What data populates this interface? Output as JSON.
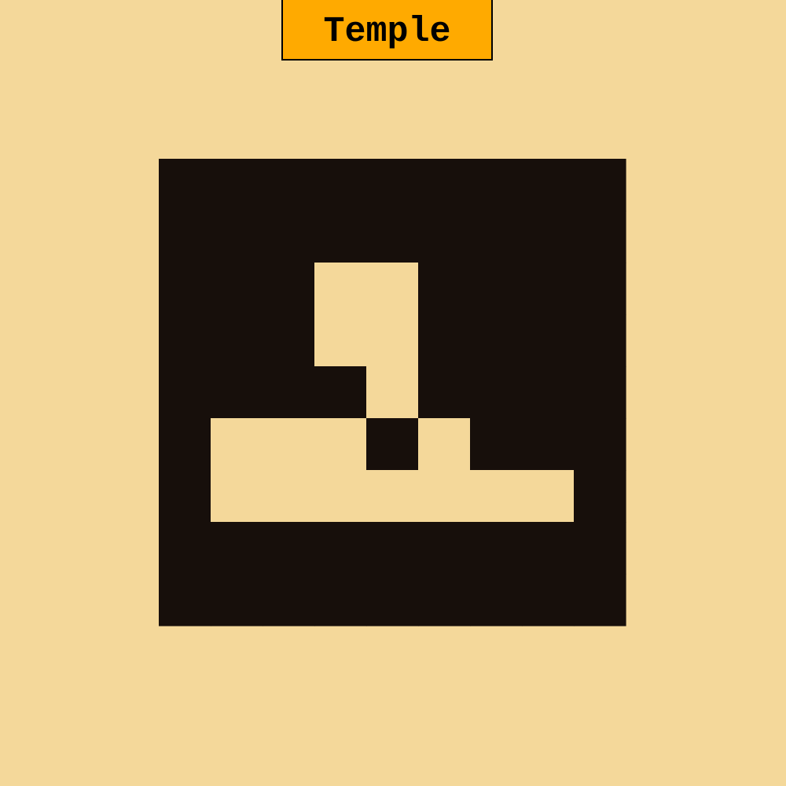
{
  "title": "Temple",
  "colors": {
    "background": "#f4d89a",
    "wall": "#170f0b",
    "floor": "#f4d89a",
    "badge_fill": "#ffaa00",
    "badge_border": "#000000"
  },
  "grid": {
    "rows": 9,
    "cols": 9,
    "cells": [
      "#########",
      "#########",
      "###..####",
      "###..####",
      "####.####",
      "#...#.###",
      "#.......#",
      "#########",
      "#########"
    ]
  }
}
